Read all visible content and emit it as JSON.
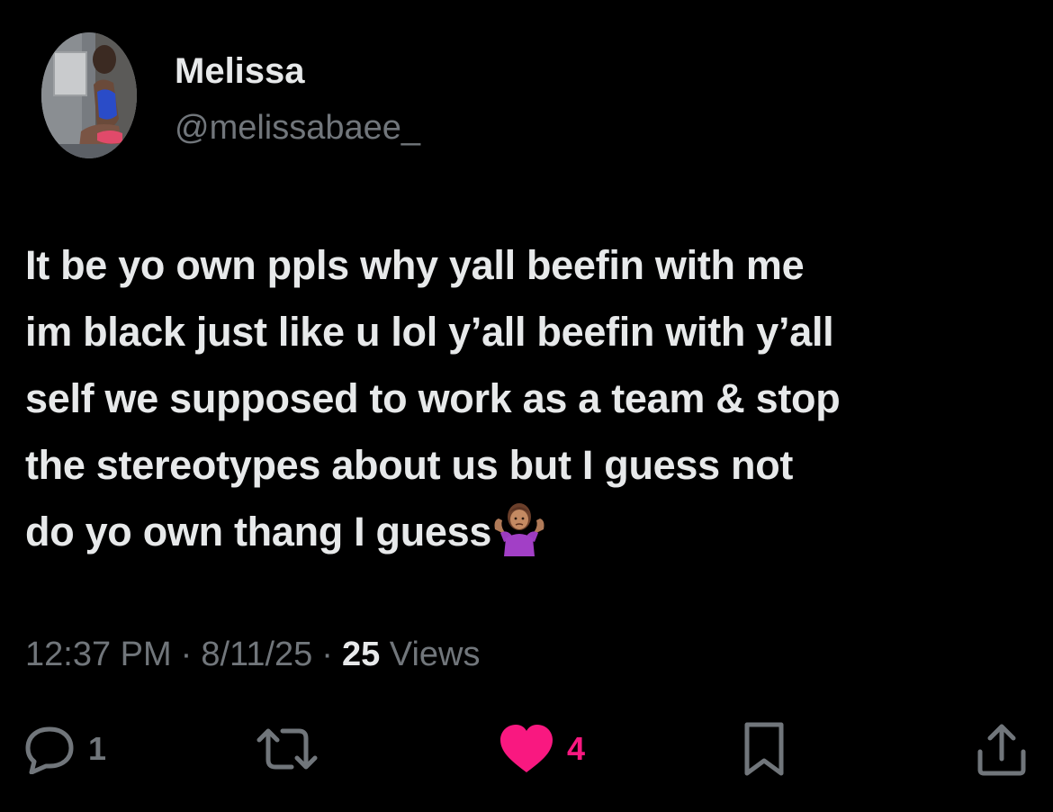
{
  "tweet": {
    "author": {
      "display_name": "Melissa",
      "handle": "@melissabaee_"
    },
    "text_lines": [
      "It be yo own ppls why yall beefin with me",
      "im black just like u lol y’all beefin with y’all",
      "self we supposed to work as a team & stop",
      "the stereotypes about us but I guess not",
      "do yo own thang I guess"
    ],
    "emoji": "🤷🏽‍♀️",
    "meta": {
      "time": "12:37 PM",
      "date": "8/11/25",
      "separator": "·",
      "views_count": "25",
      "views_label": "Views"
    },
    "actions": {
      "replies": "1",
      "likes": "4"
    }
  },
  "colors": {
    "background": "#000000",
    "text_primary": "#e7e9ea",
    "text_secondary": "#71767b",
    "like_accent": "#f91880"
  },
  "icons": {
    "reply": "speech-bubble-icon",
    "retweet": "retweet-icon",
    "like": "heart-filled-icon",
    "bookmark": "bookmark-icon",
    "share": "share-icon"
  }
}
